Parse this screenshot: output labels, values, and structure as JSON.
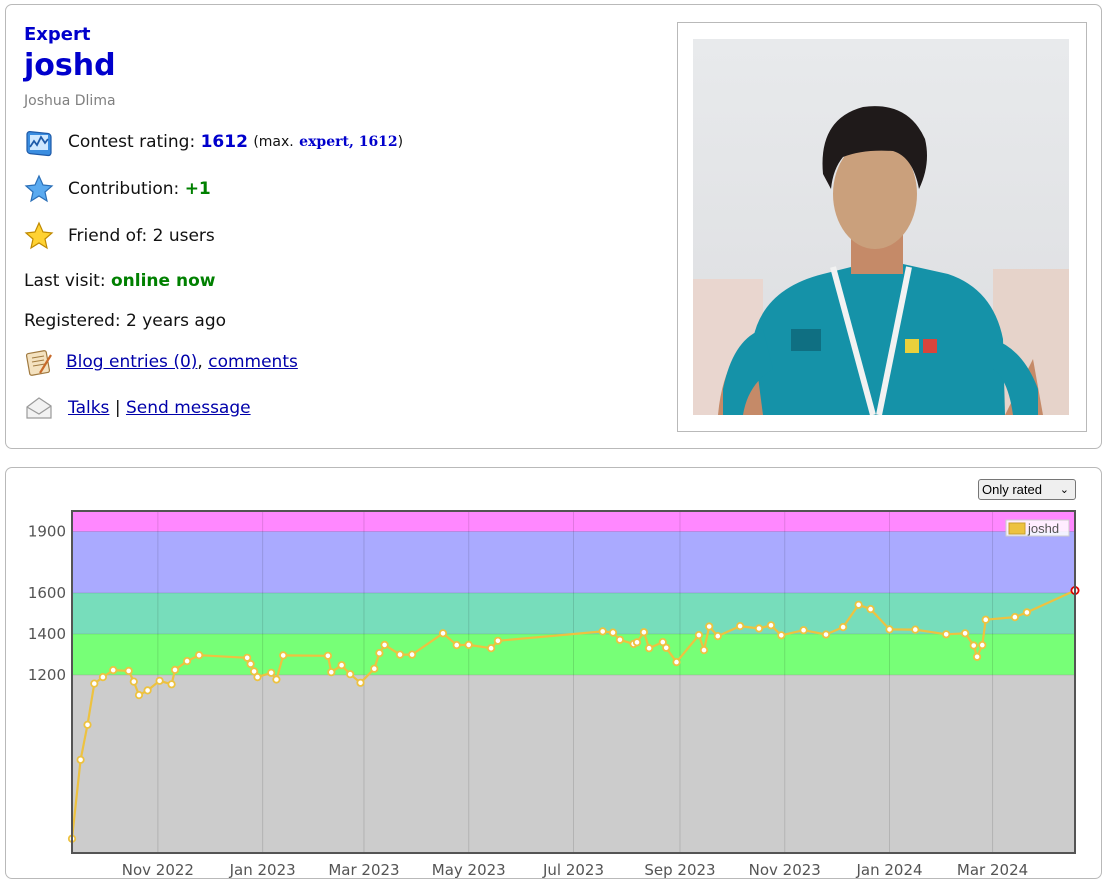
{
  "profile": {
    "rank": "Expert",
    "handle": "joshd",
    "real_name": "Joshua Dlima",
    "rating_label": "Contest rating:",
    "rating_value": "1612",
    "max_prefix": "(max.",
    "max_rank_value": "expert, 1612",
    "max_suffix": ")",
    "contribution_label": "Contribution:",
    "contribution_value": "+1",
    "friend_label": "Friend of:",
    "friend_value": "2 users",
    "last_visit_label": "Last visit:",
    "last_visit_value": "online now",
    "registered_label": "Registered:",
    "registered_value": "2 years ago",
    "blog_entries_link": "Blog entries (0)",
    "separator_comma": ",",
    "comments_link": "comments",
    "talks_link": "Talks",
    "separator_pipe": "|",
    "send_message_link": "Send message"
  },
  "icons": {
    "rating": "rating-chart-icon",
    "contribution": "blue-star-icon",
    "friend": "gold-star-icon",
    "blog": "blog-notepad-icon",
    "talks": "envelope-icon"
  },
  "graph_controls": {
    "filter_selected": "Only rated",
    "filter_options": [
      "Only rated"
    ]
  },
  "colors": {
    "rank_blue": "#0000cc",
    "positive_green": "#008000",
    "band_newbie": "#cccccc",
    "band_pupil": "#77ff77",
    "band_specialist": "#77ddbb",
    "band_expert": "#aaaaff",
    "band_cm": "#ff88ff",
    "series_line": "#edc240"
  },
  "chart_data": {
    "type": "line",
    "legend": "joshd",
    "legend_position": "top-right",
    "x_ticks": [
      "Nov 2022",
      "Jan 2023",
      "Mar 2023",
      "May 2023",
      "Jul 2023",
      "Sep 2023",
      "Nov 2023",
      "Jan 2024",
      "Mar 2024"
    ],
    "y_ticks": [
      1200,
      1400,
      1600,
      1900
    ],
    "x_range": [
      "2022-09-12",
      "2024-04-18"
    ],
    "y_range": [
      330,
      2000
    ],
    "grid": true,
    "bands": [
      {
        "from": 0,
        "to": 1200,
        "color": "#cccccc"
      },
      {
        "from": 1200,
        "to": 1400,
        "color": "#77ff77"
      },
      {
        "from": 1400,
        "to": 1600,
        "color": "#77ddbb"
      },
      {
        "from": 1600,
        "to": 1900,
        "color": "#aaaaff"
      },
      {
        "from": 1900,
        "to": 2100,
        "color": "#ff88ff"
      }
    ],
    "series": [
      {
        "name": "joshd",
        "points": [
          [
            "2022-09-12",
            400
          ],
          [
            "2022-09-17",
            785
          ],
          [
            "2022-09-21",
            956
          ],
          [
            "2022-09-25",
            1157
          ],
          [
            "2022-09-30",
            1189
          ],
          [
            "2022-10-06",
            1223
          ],
          [
            "2022-10-15",
            1219
          ],
          [
            "2022-10-18",
            1167
          ],
          [
            "2022-10-21",
            1101
          ],
          [
            "2022-10-26",
            1124
          ],
          [
            "2022-11-02",
            1171
          ],
          [
            "2022-11-09",
            1154
          ],
          [
            "2022-11-11",
            1224
          ],
          [
            "2022-11-18",
            1267
          ],
          [
            "2022-11-25",
            1296
          ],
          [
            "2022-12-23",
            1283
          ],
          [
            "2022-12-25",
            1253
          ],
          [
            "2022-12-27",
            1217
          ],
          [
            "2022-12-29",
            1189
          ],
          [
            "2023-01-06",
            1210
          ],
          [
            "2023-01-09",
            1177
          ],
          [
            "2023-01-13",
            1295
          ],
          [
            "2023-02-08",
            1293
          ],
          [
            "2023-02-10",
            1213
          ],
          [
            "2023-02-16",
            1247
          ],
          [
            "2023-02-21",
            1203
          ],
          [
            "2023-02-27",
            1161
          ],
          [
            "2023-03-07",
            1230
          ],
          [
            "2023-03-10",
            1306
          ],
          [
            "2023-03-13",
            1346
          ],
          [
            "2023-03-22",
            1299
          ],
          [
            "2023-03-29",
            1299
          ],
          [
            "2023-04-16",
            1403
          ],
          [
            "2023-04-24",
            1345
          ],
          [
            "2023-05-01",
            1346
          ],
          [
            "2023-05-14",
            1330
          ],
          [
            "2023-05-18",
            1366
          ],
          [
            "2023-07-18",
            1412
          ],
          [
            "2023-07-24",
            1406
          ],
          [
            "2023-07-28",
            1371
          ],
          [
            "2023-08-05",
            1351
          ],
          [
            "2023-08-07",
            1359
          ],
          [
            "2023-08-11",
            1408
          ],
          [
            "2023-08-14",
            1330
          ],
          [
            "2023-08-22",
            1360
          ],
          [
            "2023-08-24",
            1332
          ],
          [
            "2023-08-30",
            1262
          ],
          [
            "2023-09-12",
            1394
          ],
          [
            "2023-09-15",
            1321
          ],
          [
            "2023-09-18",
            1436
          ],
          [
            "2023-09-23",
            1389
          ],
          [
            "2023-10-06",
            1438
          ],
          [
            "2023-10-17",
            1426
          ],
          [
            "2023-10-24",
            1442
          ],
          [
            "2023-10-30",
            1393
          ],
          [
            "2023-11-12",
            1418
          ],
          [
            "2023-11-25",
            1397
          ],
          [
            "2023-12-05",
            1433
          ],
          [
            "2023-12-14",
            1542
          ],
          [
            "2023-12-21",
            1521
          ],
          [
            "2024-01-01",
            1422
          ],
          [
            "2024-01-16",
            1421
          ],
          [
            "2024-02-03",
            1398
          ],
          [
            "2024-02-14",
            1403
          ],
          [
            "2024-02-19",
            1343
          ],
          [
            "2024-02-21",
            1288
          ],
          [
            "2024-02-24",
            1345
          ],
          [
            "2024-02-26",
            1469
          ],
          [
            "2024-03-14",
            1482
          ],
          [
            "2024-03-21",
            1505
          ],
          [
            "2024-04-18",
            1612
          ]
        ]
      }
    ]
  }
}
